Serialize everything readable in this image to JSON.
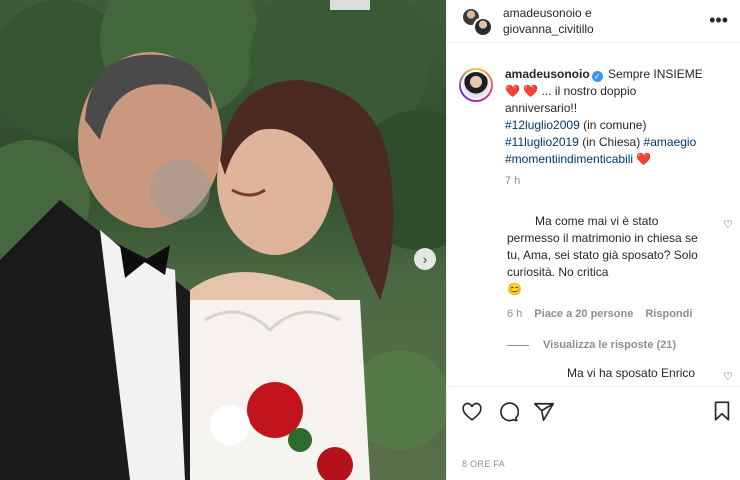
{
  "header": {
    "title_line1": "amadeusonoio e",
    "title_line2": "giovanna_civitillo",
    "more_icon": "more-horizontal-icon"
  },
  "caption": {
    "username": "amadeusonoio",
    "line1": "Sempre INSIEME",
    "hearts": "❤️ ❤️",
    "line2": "... il nostro doppio",
    "line3": "anniversario!!",
    "tag1": "#12luglio2009",
    "tag1_suffix": " (in comune)",
    "tag2": "#11luglio2019",
    "tag2_suffix": " (in Chiesa) ",
    "tag3": "#amaegio",
    "tag4": "#momentiindimenticabili",
    "tag4_heart": " ❤️",
    "time": "7 h"
  },
  "comments": [
    {
      "text": "Ma come mai vi è stato permesso il matrimonio in chiesa se tu, Ama, sei stato già sposato? Solo curiosità. No critica",
      "emoji": "😊",
      "time": "6 h",
      "likes": "Piace a 20 persone",
      "reply": "Rispondi",
      "view_replies": "Visualizza le risposte (21)"
    },
    {
      "text": "Ma vi ha sposato Enrico"
    }
  ],
  "actions": {
    "like_icon": "heart-icon",
    "comment_icon": "comment-icon",
    "share_icon": "share-icon",
    "save_icon": "bookmark-icon"
  },
  "post_time": "8 ORE FA",
  "colors": {
    "link": "#00376b",
    "verified": "#3897f0",
    "muted": "#8e8e8e",
    "heart": "#ed1c3e"
  }
}
